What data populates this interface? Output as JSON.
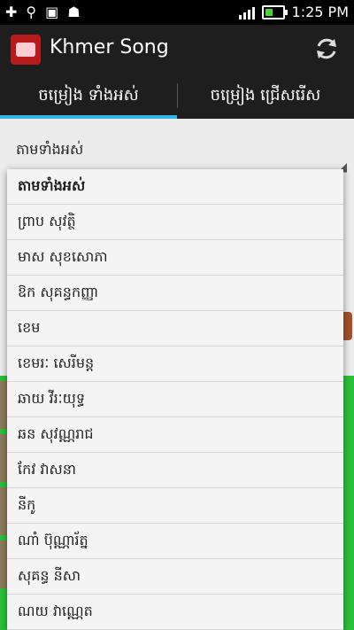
{
  "status": {
    "time": "1:25",
    "ampm": "PM"
  },
  "app": {
    "title": "Khmer Song"
  },
  "tabs": [
    {
      "label": "ចម្រៀង ទាំងអស់"
    },
    {
      "label": "ចម្រៀង ជ្រើសរើស"
    }
  ],
  "filter": {
    "selected": "តាមទាំងអស់"
  },
  "dropdown": {
    "items": [
      "តាមទាំងអស់",
      "ព្រាប សុវត្ថិ",
      "មាស សុខសោភា",
      "ឱក សុគន្ធកញ្ញា",
      "ខេម",
      "ខេមរៈ សេរីមន្ត",
      "ឆាយ វីរៈយុទ្ធ",
      "ឆន សុវណ្ណរាជ",
      "កែវ វាសនា",
      "នីកូ",
      "ណាំ ប៊ុណ្ណារ័ត្ន",
      "សុគន្ធ នីសា",
      "ណយ វាណ្ណេត"
    ]
  },
  "colors": {
    "accent": "#33b5e5",
    "appbar": "#1e1e1e",
    "green": "#2cc13b"
  }
}
